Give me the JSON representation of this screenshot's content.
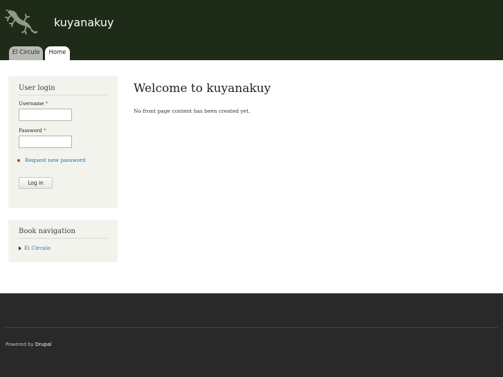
{
  "header": {
    "site_name": "kuyanakuy",
    "logo": "lizard-logo",
    "tabs": [
      {
        "label": "El Circulo",
        "active": false
      },
      {
        "label": "Home",
        "active": true
      }
    ],
    "background": "#1f2b19"
  },
  "sidebar": {
    "login": {
      "title": "User login",
      "username_label": "Username",
      "password_label": "Password",
      "required_mark": "*",
      "username_value": "",
      "password_value": "",
      "request_password": "Request new password",
      "login_button": "Log in"
    },
    "book": {
      "title": "Book navigation",
      "items": [
        "El Círculo"
      ]
    }
  },
  "main": {
    "title": "Welcome to kuyanakuy",
    "text": "No front page content has been created yet."
  },
  "footer": {
    "powered_prefix": "Powered by",
    "powered_link": "Drupal",
    "background": "#292929"
  },
  "colors": {
    "link": "#1d70a8",
    "required": "#d03030"
  }
}
